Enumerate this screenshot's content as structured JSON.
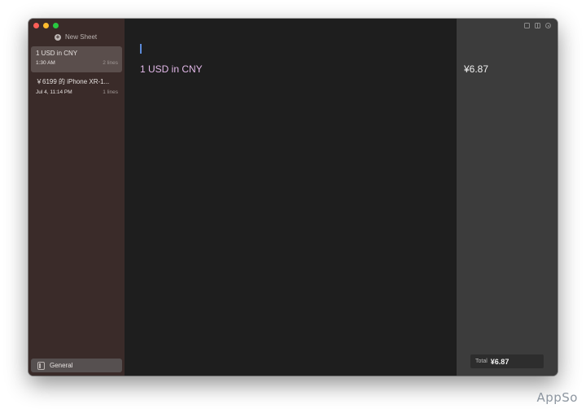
{
  "sidebar": {
    "new_sheet_label": "New Sheet",
    "sheets": [
      {
        "title": "1 USD in CNY",
        "time": "1:30 AM",
        "lines": "2 lines",
        "selected": true
      },
      {
        "title": "￥6199 的 iPhone XR-1...",
        "time": "Jul 4, 11:14 PM",
        "lines": "1 lines",
        "selected": false
      }
    ],
    "footer_label": "General"
  },
  "editor": {
    "lines": [
      "1 USD in CNY"
    ]
  },
  "results": {
    "values": [
      "¥6.87"
    ],
    "total_label": "Total",
    "total_value": "¥6.87"
  },
  "colors": {
    "sidebar_bg": "#3a2b29",
    "editor_bg": "#1e1e1e",
    "results_bg": "#3c3c3c",
    "expression_text": "#e2b8e8",
    "caret": "#5b8ad8"
  },
  "icons": [
    "plus-circle-icon",
    "sheet-icon",
    "single-pane-icon",
    "split-pane-icon",
    "settings-icon"
  ],
  "watermark": "AppSo"
}
